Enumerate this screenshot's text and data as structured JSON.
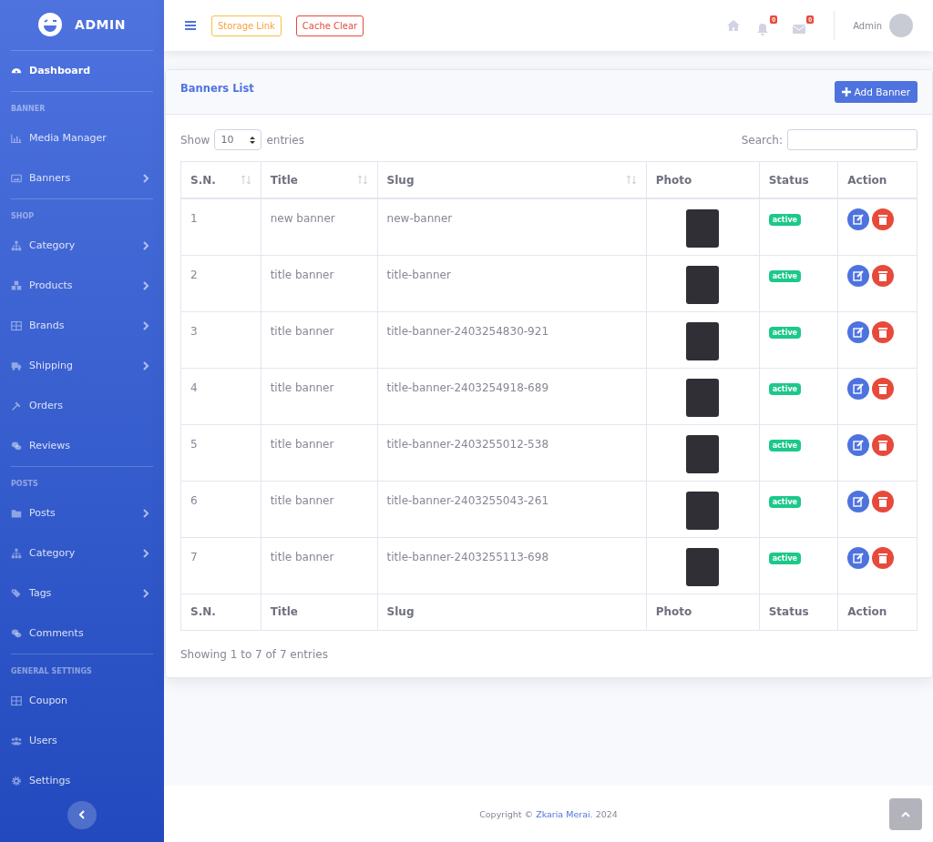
{
  "brand": {
    "title": "ADMIN"
  },
  "sidebar": {
    "items": [
      {
        "kind": "item",
        "label": "Dashboard",
        "selected": true,
        "has_submenu": false
      },
      {
        "kind": "divider"
      },
      {
        "kind": "heading",
        "label": "BANNER"
      },
      {
        "kind": "item",
        "label": "Media Manager",
        "selected": false,
        "has_submenu": false
      },
      {
        "kind": "item",
        "label": "Banners",
        "selected": false,
        "has_submenu": true
      },
      {
        "kind": "divider"
      },
      {
        "kind": "heading",
        "label": "SHOP"
      },
      {
        "kind": "item",
        "label": "Category",
        "selected": false,
        "has_submenu": true
      },
      {
        "kind": "item",
        "label": "Products",
        "selected": false,
        "has_submenu": true
      },
      {
        "kind": "item",
        "label": "Brands",
        "selected": false,
        "has_submenu": true
      },
      {
        "kind": "item",
        "label": "Shipping",
        "selected": false,
        "has_submenu": true
      },
      {
        "kind": "item",
        "label": "Orders",
        "selected": false,
        "has_submenu": false
      },
      {
        "kind": "item",
        "label": "Reviews",
        "selected": false,
        "has_submenu": false
      },
      {
        "kind": "divider"
      },
      {
        "kind": "heading",
        "label": "POSTS"
      },
      {
        "kind": "item",
        "label": "Posts",
        "selected": false,
        "has_submenu": true
      },
      {
        "kind": "item",
        "label": "Category",
        "selected": false,
        "has_submenu": true
      },
      {
        "kind": "item",
        "label": "Tags",
        "selected": false,
        "has_submenu": true
      },
      {
        "kind": "item",
        "label": "Comments",
        "selected": false,
        "has_submenu": false
      },
      {
        "kind": "divider"
      },
      {
        "kind": "heading",
        "label": "GENERAL SETTINGS"
      },
      {
        "kind": "item",
        "label": "Coupon",
        "selected": false,
        "has_submenu": false
      },
      {
        "kind": "item",
        "label": "Users",
        "selected": false,
        "has_submenu": false
      },
      {
        "kind": "item",
        "label": "Settings",
        "selected": false,
        "has_submenu": false
      }
    ]
  },
  "topbar": {
    "buttons": [
      {
        "label": "Storage Link",
        "kind": "warning"
      },
      {
        "label": "Cache Clear",
        "kind": "danger"
      }
    ],
    "notifications": {
      "alerts": "0",
      "messages": "0"
    },
    "user": "Admin"
  },
  "card": {
    "title": "Banners List",
    "add_button": "Add Banner"
  },
  "table_controls": {
    "show": "Show",
    "page_size": "10",
    "entries": "entries",
    "search_label": "Search:"
  },
  "table": {
    "columns": [
      {
        "label": "S.N.",
        "sortable": true
      },
      {
        "label": "Title",
        "sortable": true
      },
      {
        "label": "Slug",
        "sortable": true
      },
      {
        "label": "Photo",
        "sortable": false
      },
      {
        "label": "Status",
        "sortable": false
      },
      {
        "label": "Action",
        "sortable": false
      }
    ],
    "rows": [
      {
        "sn": "1",
        "title": "new banner",
        "slug": "new-banner",
        "status": "active"
      },
      {
        "sn": "2",
        "title": "title banner",
        "slug": "title-banner",
        "status": "active"
      },
      {
        "sn": "3",
        "title": "title banner",
        "slug": "title-banner-2403254830-921",
        "status": "active"
      },
      {
        "sn": "4",
        "title": "title banner",
        "slug": "title-banner-2403254918-689",
        "status": "active"
      },
      {
        "sn": "5",
        "title": "title banner",
        "slug": "title-banner-2403255012-538",
        "status": "active"
      },
      {
        "sn": "6",
        "title": "title banner",
        "slug": "title-banner-2403255043-261",
        "status": "active"
      },
      {
        "sn": "7",
        "title": "title banner",
        "slug": "title-banner-2403255113-698",
        "status": "active"
      }
    ],
    "footer_columns": [
      "S.N.",
      "Title",
      "Slug",
      "Photo",
      "Status",
      "Action"
    ]
  },
  "table_info": "Showing 1 to 7 of 7 entries",
  "footer": {
    "prefix": "Copyright © ",
    "author": "Zkaria Merai",
    "suffix": ". 2024"
  }
}
